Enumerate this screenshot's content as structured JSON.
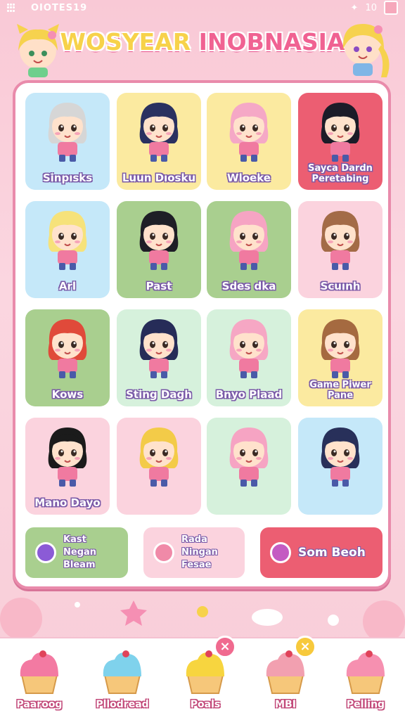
{
  "status": {
    "time": "OIOTES19",
    "signal": "10"
  },
  "title": {
    "part1": "WOSYEAR",
    "part2": "INOBNASIA"
  },
  "colors": {
    "board_border": "#e98bab",
    "blue": "#c5e8f9",
    "yellow": "#fbeaa0",
    "red": "#ec5e72",
    "green": "#a9cf8f",
    "pink": "#fbd3de",
    "mint": "#d6f1dc"
  },
  "characters": [
    {
      "name": "Sinpısks",
      "bg": "blue",
      "hair": "#d6d6d6"
    },
    {
      "name": "Luun Dıosku",
      "bg": "yellow",
      "hair": "#2a3160"
    },
    {
      "name": "Wloeke",
      "bg": "yellow",
      "hair": "#f5a8c6"
    },
    {
      "name": "Sayca Dardn Peretabing",
      "bg": "red",
      "hair": "#1c1c28"
    },
    {
      "name": "Arl",
      "bg": "blue",
      "hair": "#f6e27a"
    },
    {
      "name": "Past",
      "bg": "green",
      "hair": "#1e1e26"
    },
    {
      "name": "Sdes dka",
      "bg": "green",
      "hair": "#f6a4c3"
    },
    {
      "name": "Scuınh",
      "bg": "pink",
      "hair": "#a36b47"
    },
    {
      "name": "Kows",
      "bg": "green",
      "hair": "#e04a3a"
    },
    {
      "name": "Sting Dagh",
      "bg": "mint",
      "hair": "#262c58"
    },
    {
      "name": "Bnyo Plaad",
      "bg": "mint",
      "hair": "#f6a7c4"
    },
    {
      "name": "Game Piwer Pane",
      "bg": "yellow",
      "hair": "#a56a40"
    },
    {
      "name": "Mano Dayo",
      "bg": "pink",
      "hair": "#1b1b1b"
    },
    {
      "name": "",
      "bg": "pink",
      "hair": "#f3cb48"
    },
    {
      "name": "",
      "bg": "mint",
      "hair": "#f6a4c3"
    },
    {
      "name": "",
      "bg": "blue",
      "hair": "#28305a"
    }
  ],
  "actions": [
    {
      "label": "Kast Negan Bleam",
      "bg": "#a9cf8f",
      "icon": "lollipop-icon"
    },
    {
      "label": "Rada Ningan Fesae",
      "bg": "#fbd3de",
      "icon": "candy-wand-icon"
    },
    {
      "label": "Som Beoh",
      "bg": "#ec5e72",
      "icon": "berry-box-icon"
    }
  ],
  "nav": [
    {
      "label": "Paaroog",
      "icon": "cupcake-icon",
      "frosting": "#f37aa2"
    },
    {
      "label": "Pllodread",
      "icon": "cupcake-icon",
      "frosting": "#7fd2ec"
    },
    {
      "label": "Poals",
      "icon": "pudding-icon",
      "frosting": "#f7d53f",
      "badge": "×"
    },
    {
      "label": "MBI",
      "icon": "muffin-icon",
      "frosting": "#f2a0b0",
      "badge": "×"
    },
    {
      "label": "Pelling",
      "icon": "cup-icon",
      "frosting": "#f690b0"
    }
  ]
}
